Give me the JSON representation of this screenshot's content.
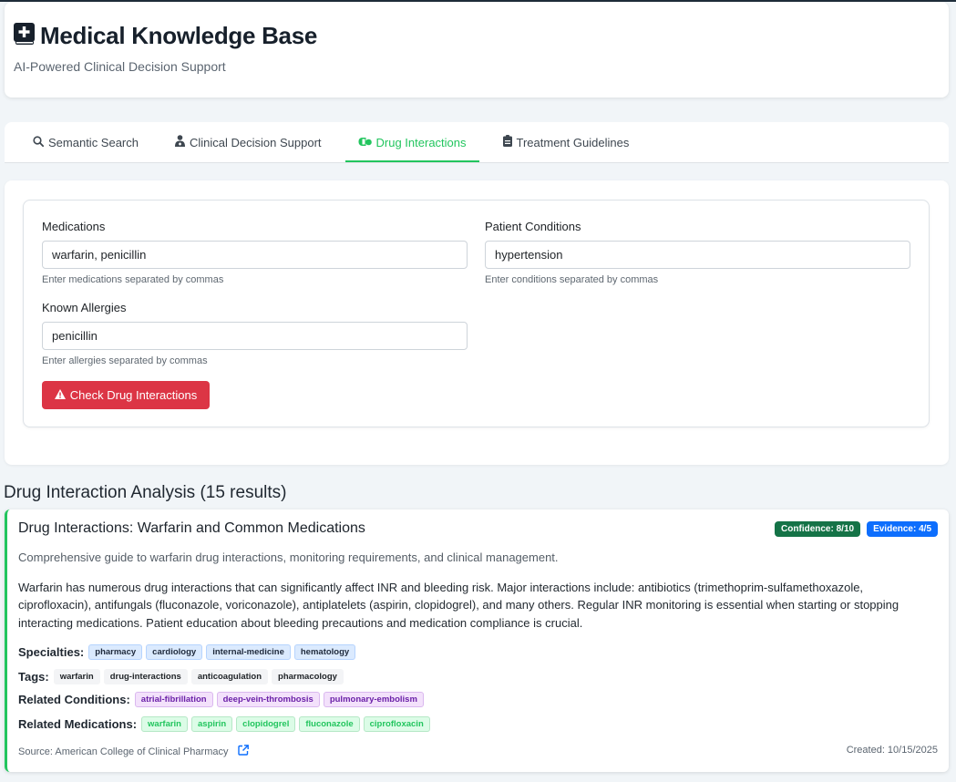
{
  "header": {
    "title": "Medical Knowledge Base",
    "subtitle": "AI-Powered Clinical Decision Support",
    "icon": "medical-book-icon"
  },
  "tabs": [
    {
      "label": "Semantic Search",
      "icon": "search-icon",
      "active": false
    },
    {
      "label": "Clinical Decision Support",
      "icon": "doctor-icon",
      "active": false
    },
    {
      "label": "Drug Interactions",
      "icon": "pills-icon",
      "active": true
    },
    {
      "label": "Treatment Guidelines",
      "icon": "clipboard-icon",
      "active": false
    }
  ],
  "form": {
    "medications": {
      "label": "Medications",
      "value": "warfarin, penicillin",
      "help": "Enter medications separated by commas"
    },
    "conditions": {
      "label": "Patient Conditions",
      "value": "hypertension",
      "help": "Enter conditions separated by commas"
    },
    "allergies": {
      "label": "Known Allergies",
      "value": "penicillin",
      "help": "Enter allergies separated by commas"
    },
    "submit_label": "Check Drug Interactions"
  },
  "results": {
    "heading": "Drug Interaction Analysis (15 results)",
    "items": [
      {
        "title": "Drug Interactions: Warfarin and Common Medications",
        "confidence": "Confidence: 8/10",
        "evidence": "Evidence: 4/5",
        "summary": "Comprehensive guide to warfarin drug interactions, monitoring requirements, and clinical management.",
        "body": "Warfarin has numerous drug interactions that can significantly affect INR and bleeding risk. Major interactions include: antibiotics (trimethoprim-sulfamethoxazole, ciprofloxacin), antifungals (fluconazole, voriconazole), antiplatelets (aspirin, clopidogrel), and many others. Regular INR monitoring is essential when starting or stopping interacting medications. Patient education about bleeding precautions and medication compliance is crucial.",
        "specialties_label": "Specialties:",
        "specialties": [
          "pharmacy",
          "cardiology",
          "internal-medicine",
          "hematology"
        ],
        "tags_label": "Tags:",
        "tags": [
          "warfarin",
          "drug-interactions",
          "anticoagulation",
          "pharmacology"
        ],
        "conditions_label": "Related Conditions:",
        "conditions": [
          "atrial-fibrillation",
          "deep-vein-thrombosis",
          "pulmonary-embolism"
        ],
        "medications_label": "Related Medications:",
        "medications": [
          "warfarin",
          "aspirin",
          "clopidogrel",
          "fluconazole",
          "ciprofloxacin"
        ],
        "source": "Source: American College of Clinical Pharmacy",
        "created": "Created: 10/15/2025"
      }
    ]
  },
  "colors": {
    "accent": "#22c55e",
    "danger": "#dc3545",
    "confidence_badge": "#157347",
    "evidence_badge": "#0d6efd",
    "link": "#0d6efd"
  }
}
